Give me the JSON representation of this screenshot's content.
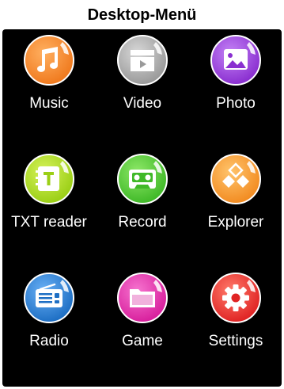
{
  "title": "Desktop-Menü",
  "apps": [
    {
      "label": "Music",
      "icon": "music-note-icon",
      "color": "#f07a1e",
      "color_light": "#ffb061"
    },
    {
      "label": "Video",
      "icon": "film-clapper-icon",
      "color": "#9a9a9a",
      "color_light": "#d8d8d8"
    },
    {
      "label": "Photo",
      "icon": "image-icon",
      "color": "#8a2fd0",
      "color_light": "#c483f6"
    },
    {
      "label": "TXT reader",
      "icon": "text-document-icon",
      "color": "#9bcf16",
      "color_light": "#d6f25a"
    },
    {
      "label": "Record",
      "icon": "cassette-icon",
      "color": "#40b928",
      "color_light": "#8ee868"
    },
    {
      "label": "Explorer",
      "icon": "diamonds-icon",
      "color": "#f28c22",
      "color_light": "#ffc46c"
    },
    {
      "label": "Radio",
      "icon": "radio-icon",
      "color": "#1e6fc4",
      "color_light": "#69b0f5"
    },
    {
      "label": "Game",
      "icon": "folder-icon",
      "color": "#d8209d",
      "color_light": "#f674cf"
    },
    {
      "label": "Settings",
      "icon": "gear-icon",
      "color": "#e02424",
      "color_light": "#ff7a6a"
    }
  ]
}
